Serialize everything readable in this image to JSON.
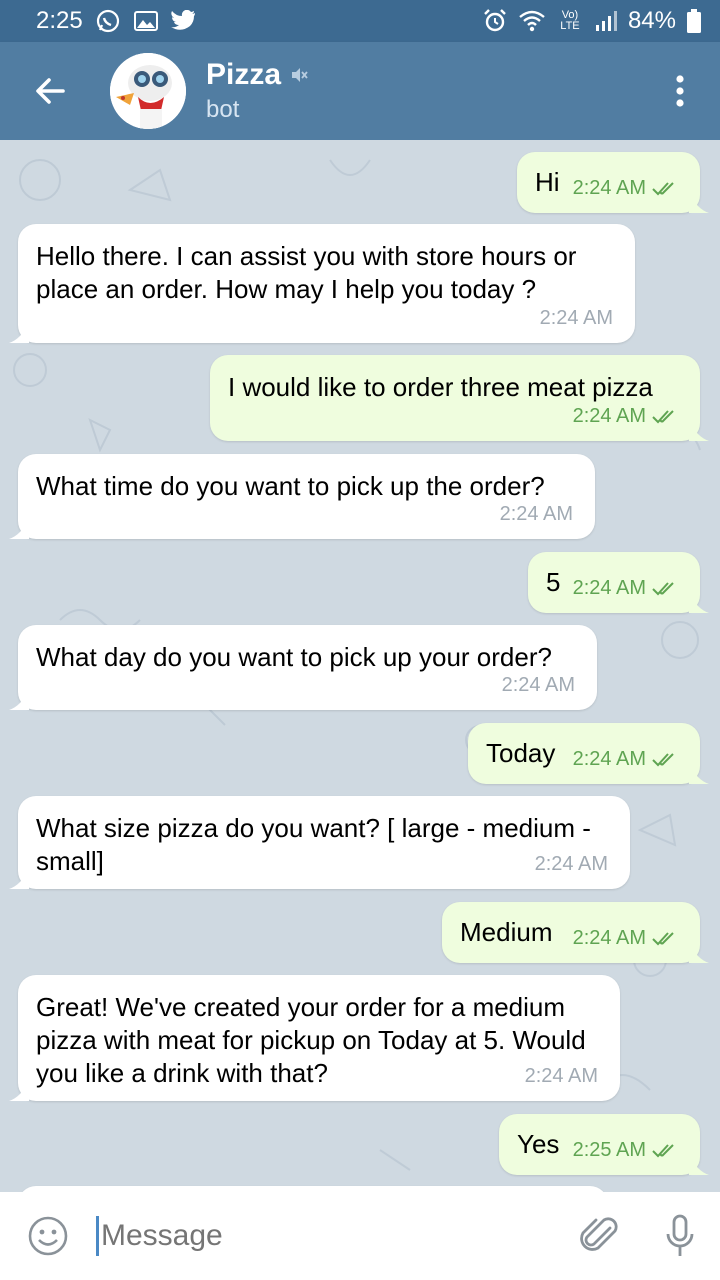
{
  "status_bar": {
    "time": "2:25",
    "battery": "84%",
    "network": "Vo) LTE"
  },
  "header": {
    "title": "Pizza",
    "subtitle": "bot"
  },
  "messages": [
    {
      "dir": "out",
      "text": "Hi",
      "time": "2:24 AM"
    },
    {
      "dir": "in",
      "text": "Hello there. I can assist you with store hours or place an order. How may I help you today ?",
      "time": "2:24 AM"
    },
    {
      "dir": "out",
      "text": "I would like to order three meat pizza",
      "time": "2:24 AM"
    },
    {
      "dir": "in",
      "text": "What time do you want to pick up the order?",
      "time": "2:24 AM"
    },
    {
      "dir": "out",
      "text": "5",
      "time": "2:24 AM"
    },
    {
      "dir": "in",
      "text": "What day do you want to pick up your order?",
      "time": "2:24 AM"
    },
    {
      "dir": "out",
      "text": "Today",
      "time": "2:24 AM"
    },
    {
      "dir": "in",
      "text": "What size pizza do you want? [ large - medium - small]",
      "time": "2:24 AM"
    },
    {
      "dir": "out",
      "text": "Medium",
      "time": "2:24 AM"
    },
    {
      "dir": "in",
      "text": "Great! We've created your order for a medium pizza with meat for pickup on Today at 5. Would you like a drink with that?",
      "time": "2:24 AM"
    },
    {
      "dir": "out",
      "text": "Yes",
      "time": "2:25 AM"
    }
  ],
  "input": {
    "placeholder": "Message"
  },
  "icons": {
    "back": "arrow-left-icon",
    "menu": "more-vert-icon",
    "mute": "muted-speaker-icon",
    "emoji": "smiley-icon",
    "attach": "paperclip-icon",
    "mic": "microphone-icon",
    "read": "double-check-icon"
  },
  "colors": {
    "header": "#517da2",
    "status_bar": "#3d6a91",
    "outgoing": "#effdde",
    "incoming": "#ffffff",
    "check": "#5fa452"
  }
}
